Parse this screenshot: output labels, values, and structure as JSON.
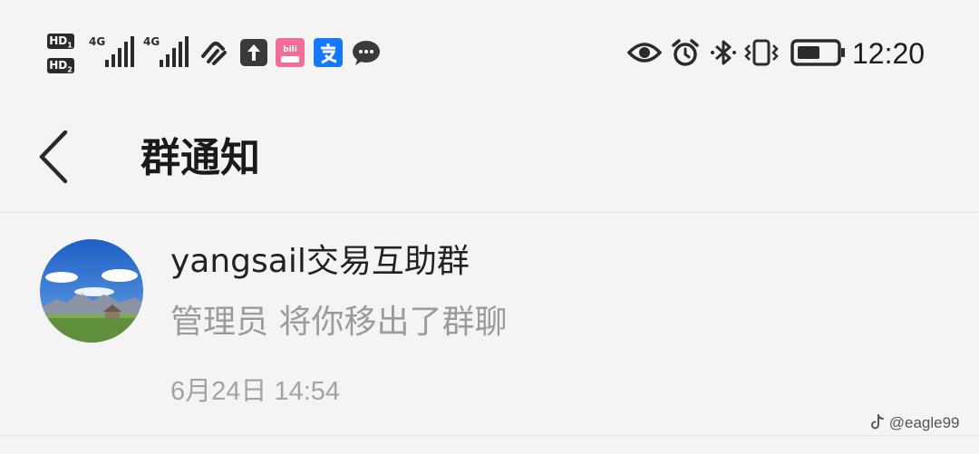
{
  "status_bar": {
    "hd_label": "HD",
    "hd_index_1": "1",
    "hd_index_2": "2",
    "signal_1_label": "4G",
    "signal_2_label": "4G",
    "time": "12:20",
    "icons": [
      "hd-sim-icon",
      "signal-4g-icon",
      "data-saver-icon",
      "upload-icon",
      "bilibili-icon",
      "alipay-icon",
      "chat-icon",
      "eye-comfort-icon",
      "alarm-icon",
      "bluetooth-icon",
      "vibrate-icon",
      "battery-icon"
    ]
  },
  "header": {
    "title": "群通知",
    "back_icon": "chevron-left-icon"
  },
  "notifications": [
    {
      "group_name": "yangsail交易互助群",
      "message": "管理员 将你移出了群聊",
      "timestamp": "6月24日 14:54",
      "avatar": "landscape-avatar"
    }
  ],
  "watermark": {
    "text": "@eagle99",
    "icon": "tiktok-icon"
  },
  "colors": {
    "background": "#f4f4f4",
    "title_text": "#1a1a1a",
    "secondary_text": "#9b9b9b",
    "divider": "#e2e2e2",
    "bilibili_pink": "#f36d9a",
    "alipay_blue": "#1677ff"
  }
}
